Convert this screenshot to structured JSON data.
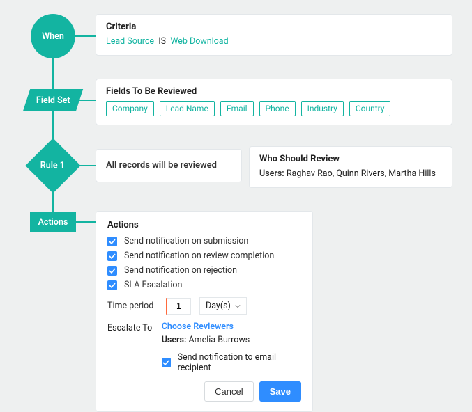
{
  "nodes": {
    "when": "When",
    "fieldset": "Field Set",
    "rule": "Rule 1",
    "actions": "Actions"
  },
  "criteria": {
    "title": "Criteria",
    "field": "Lead Source",
    "op": "IS",
    "value": "Web Download"
  },
  "fields": {
    "title": "Fields To Be Reviewed",
    "items": [
      "Company",
      "Lead Name",
      "Email",
      "Phone",
      "Industry",
      "Country"
    ]
  },
  "rule_scope": {
    "text": "All records will be reviewed"
  },
  "who_review": {
    "title": "Who Should Review",
    "users_label": "Users:",
    "users": "Raghav Rao, Quinn Rivers, Martha Hills"
  },
  "actions_card": {
    "title": "Actions",
    "opts": [
      "Send notification on submission",
      "Send notification on review completion",
      "Send notification on rejection",
      "SLA Escalation"
    ],
    "time_label": "Time period",
    "time_value": "1",
    "time_unit": "Day(s)",
    "escalate_label": "Escalate To",
    "choose": "Choose Reviewers",
    "esc_users_label": "Users:",
    "esc_users": "Amelia Burrows",
    "notif_recipient": "Send notification to email recipient",
    "cancel": "Cancel",
    "save": "Save"
  }
}
